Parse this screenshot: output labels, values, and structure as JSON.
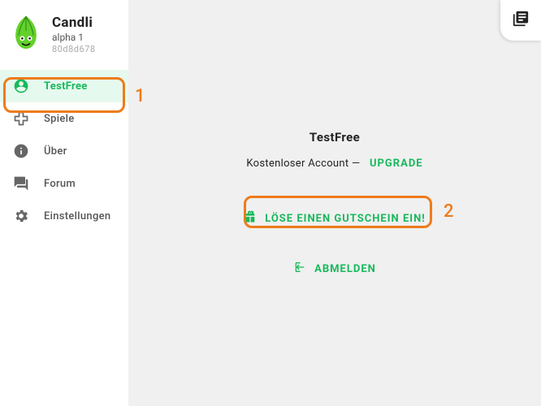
{
  "brand": {
    "name": "Candli",
    "version": "alpha 1",
    "hash": "80d8d678"
  },
  "sidebar": {
    "items": [
      {
        "label": "TestFree",
        "icon": "account-icon",
        "active": true
      },
      {
        "label": "Spiele",
        "icon": "games-icon",
        "active": false
      },
      {
        "label": "Über",
        "icon": "info-icon",
        "active": false
      },
      {
        "label": "Forum",
        "icon": "forum-icon",
        "active": false
      },
      {
        "label": "Einstellungen",
        "icon": "settings-icon",
        "active": false
      }
    ]
  },
  "main": {
    "username": "TestFree",
    "account_type": "Kostenloser Account",
    "dash": "—",
    "upgrade_label": "UPGRADE",
    "redeem_label": "LÖSE EINEN GUTSCHEIN EIN!",
    "logout_label": "ABMELDEN"
  },
  "annotations": {
    "num1": "1",
    "num2": "2"
  },
  "colors": {
    "accent": "#17b95b",
    "annotation": "#ee7b1a"
  }
}
